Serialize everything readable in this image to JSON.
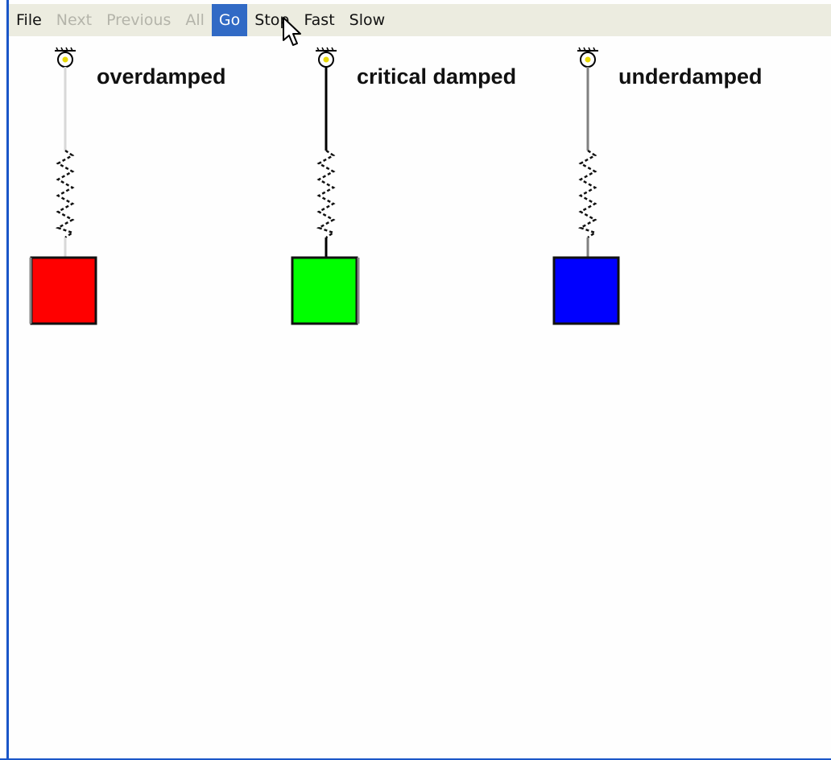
{
  "menu": {
    "items": [
      {
        "label": "File",
        "state": "enabled"
      },
      {
        "label": "Next",
        "state": "disabled"
      },
      {
        "label": "Previous",
        "state": "disabled"
      },
      {
        "label": "All",
        "state": "disabled"
      },
      {
        "label": "Go",
        "state": "active"
      },
      {
        "label": "Stop",
        "state": "enabled"
      },
      {
        "label": "Fast",
        "state": "enabled"
      },
      {
        "label": "Slow",
        "state": "enabled"
      }
    ]
  },
  "oscillators": [
    {
      "label": "overdamped",
      "mass_color": "#ff0000",
      "rod_color": "#d8d8d8"
    },
    {
      "label": "critical damped",
      "mass_color": "#00ff00",
      "rod_color": "#000000"
    },
    {
      "label": "underdamped",
      "mass_color": "#0000ff",
      "rod_color": "#808080"
    }
  ],
  "colors": {
    "menubar_bg": "#ecece0",
    "active_menu_bg": "#316ac5",
    "window_border": "#1a56c8"
  }
}
